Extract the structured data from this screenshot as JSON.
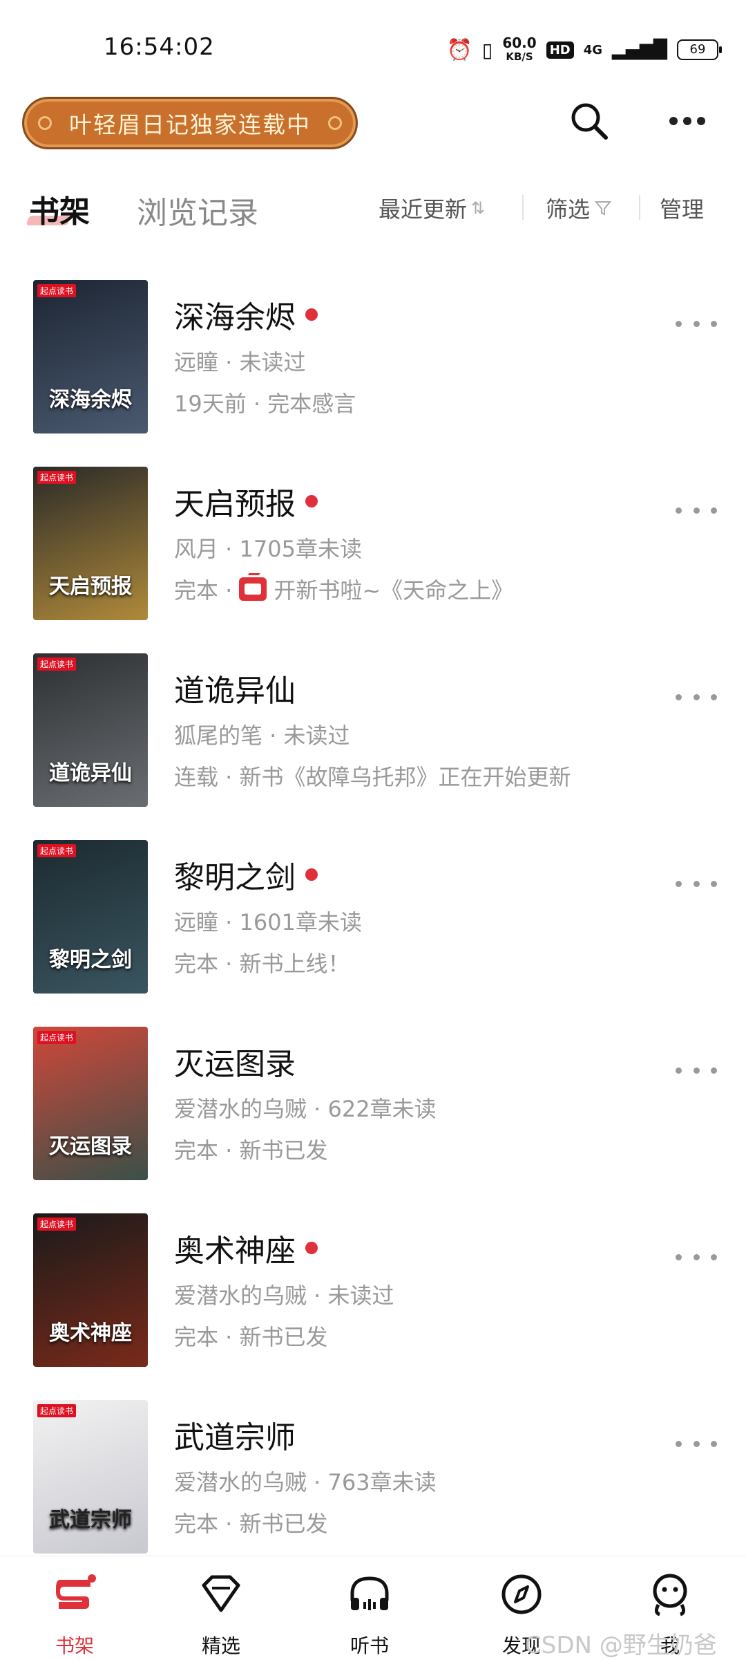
{
  "status": {
    "time": "16:54:02",
    "net_speed": "60.0",
    "net_unit": "KB/S",
    "hd": "HD",
    "network": "4G",
    "battery": "69"
  },
  "banner": {
    "text": "叶轻眉日记独家连载中"
  },
  "tabs": {
    "shelf": "书架",
    "history": "浏览记录"
  },
  "toolbar": {
    "sort": "最近更新",
    "filter": "筛选",
    "manage": "管理"
  },
  "books": [
    {
      "title": "深海余烬",
      "unread_dot": true,
      "line2": "远瞳 · 未读过",
      "line3": "19天前 · 完本感言",
      "cover_text": "深海余烬",
      "cover_color": "#1d2533",
      "cover_color2": "#4a5a70"
    },
    {
      "title": "天启预报",
      "unread_dot": true,
      "line2": "风月 · 1705章未读",
      "line3_prefix": "完本 ·",
      "line3": "开新书啦~《天命之上》",
      "cover_text": "天启预报",
      "cover_color": "#2a2a28",
      "cover_color2": "#b08a3a"
    },
    {
      "title": "道诡异仙",
      "unread_dot": false,
      "line2": "狐尾的笔 · 未读过",
      "line3": "连载 · 新书《故障乌托邦》正在开始更新",
      "cover_text": "道诡异仙",
      "cover_color": "#2d3033",
      "cover_color2": "#6a6e72"
    },
    {
      "title": "黎明之剑",
      "unread_dot": true,
      "line2": "远瞳 · 1601章未读",
      "line3": "完本 · 新书上线！",
      "cover_text": "黎明之剑",
      "cover_color": "#1c2a30",
      "cover_color2": "#3a5560"
    },
    {
      "title": "灭运图录",
      "unread_dot": false,
      "line2": "爱潜水的乌贼 · 622章未读",
      "line3": "完本 · 新书已发",
      "cover_text": "灭运图录",
      "cover_color": "#d0473a",
      "cover_color2": "#3a5048"
    },
    {
      "title": "奥术神座",
      "unread_dot": true,
      "line2": "爱潜水的乌贼 · 未读过",
      "line3": "完本 · 新书已发",
      "cover_text": "奥术神座",
      "cover_color": "#1a1a1a",
      "cover_color2": "#7a2a1a"
    },
    {
      "title": "武道宗师",
      "unread_dot": false,
      "line2": "爱潜水的乌贼 · 763章未读",
      "line3": "完本 · 新书已发",
      "cover_text": "武道宗师",
      "cover_color": "#f2f2f2",
      "cover_color2": "#c8c8d0"
    }
  ],
  "cover_brand": "起点读书",
  "nav": {
    "shelf": "书架",
    "featured": "精选",
    "listen": "听书",
    "discover": "发现",
    "me": "我"
  },
  "watermark": "CSDN @野生奶爸",
  "colors": {
    "accent": "#e0303a",
    "banner": "#c9702c"
  }
}
